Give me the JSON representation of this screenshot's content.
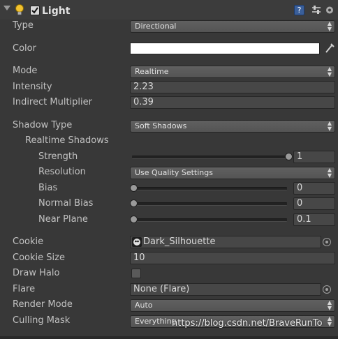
{
  "header": {
    "title": "Light",
    "enabled": true
  },
  "rows": {
    "type": {
      "label": "Type",
      "value": "Directional"
    },
    "color": {
      "label": "Color",
      "value": "#ffffff"
    },
    "mode": {
      "label": "Mode",
      "value": "Realtime"
    },
    "intensity": {
      "label": "Intensity",
      "value": "2.23"
    },
    "indirect_multiplier": {
      "label": "Indirect Multiplier",
      "value": "0.39"
    },
    "shadow_type": {
      "label": "Shadow Type",
      "value": "Soft Shadows"
    },
    "realtime_shadows": {
      "label": "Realtime Shadows"
    },
    "strength": {
      "label": "Strength",
      "value": "1",
      "level": 1.0
    },
    "resolution": {
      "label": "Resolution",
      "value": "Use Quality Settings"
    },
    "bias": {
      "label": "Bias",
      "value": "0",
      "level": 0.0
    },
    "normal_bias": {
      "label": "Normal Bias",
      "value": "0",
      "level": 0.0
    },
    "near_plane": {
      "label": "Near Plane",
      "value": "0.1",
      "level": 0.0
    },
    "cookie": {
      "label": "Cookie",
      "value": "Dark_Silhouette"
    },
    "cookie_size": {
      "label": "Cookie Size",
      "value": "10"
    },
    "draw_halo": {
      "label": "Draw Halo",
      "checked": false
    },
    "flare": {
      "label": "Flare",
      "value": "None (Flare)"
    },
    "render_mode": {
      "label": "Render Mode",
      "value": "Auto"
    },
    "culling_mask": {
      "label": "Culling Mask",
      "value": "Everything"
    }
  },
  "watermark": "https://blog.csdn.net/BraveRunTo"
}
